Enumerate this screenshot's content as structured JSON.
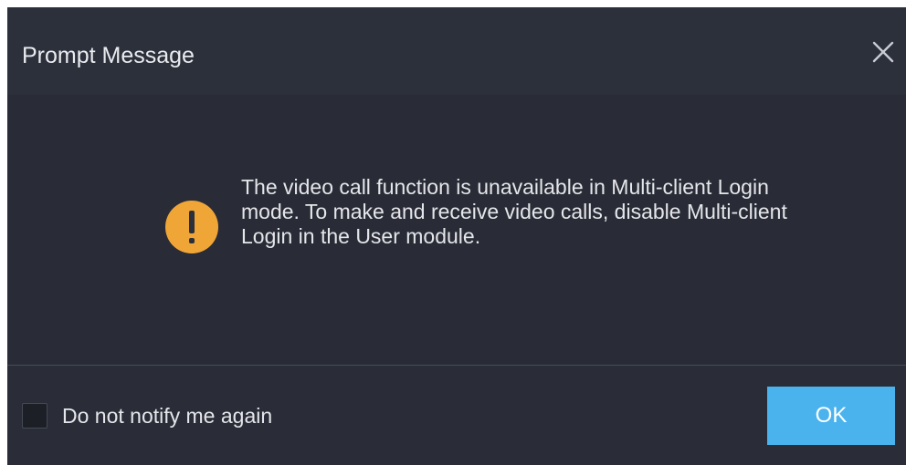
{
  "dialog": {
    "title": "Prompt Message",
    "close_icon": "close-icon",
    "warning_icon": "exclamation-warning-icon",
    "message": "The video call function is unavailable in Multi-client Login mode. To make and receive video calls, disable Multi-client Login in the User module.",
    "checkbox": {
      "label": "Do not notify me again",
      "checked": false
    },
    "ok_label": "OK",
    "colors": {
      "background": "#2b2f3a",
      "accent": "#4ab3ee",
      "warning": "#f0a637",
      "text": "#e4e6ea"
    }
  }
}
